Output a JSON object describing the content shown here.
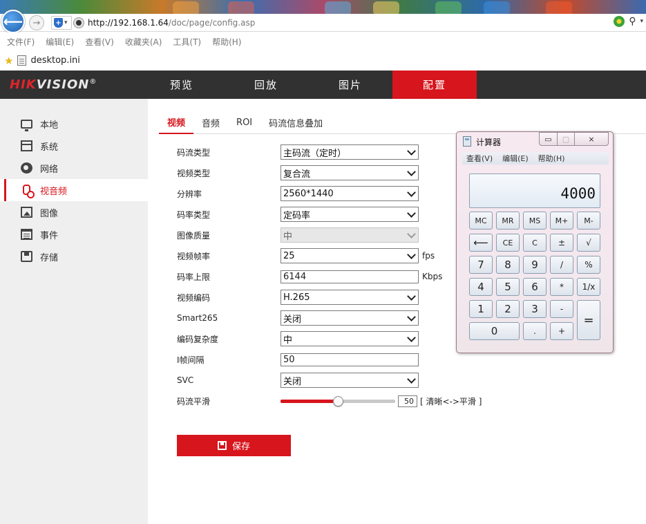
{
  "browser": {
    "url_host": "http://192.168.1.64",
    "url_path": "/doc/page/config.asp",
    "menu": [
      "文件(F)",
      "编辑(E)",
      "查看(V)",
      "收藏夹(A)",
      "工具(T)",
      "帮助(H)"
    ],
    "favorite": "desktop.ini"
  },
  "header": {
    "logo_red": "HIK",
    "logo_white": "VISION",
    "logo_reg": "®",
    "nav": [
      "预览",
      "回放",
      "图片",
      "配置"
    ],
    "active_nav": "配置"
  },
  "sidebar": {
    "items": [
      {
        "label": "本地",
        "icon": "monitor-icon"
      },
      {
        "label": "系统",
        "icon": "system-icon"
      },
      {
        "label": "网络",
        "icon": "globe-icon"
      },
      {
        "label": "视音频",
        "icon": "microphone-icon"
      },
      {
        "label": "图像",
        "icon": "image-icon"
      },
      {
        "label": "事件",
        "icon": "calendar-icon"
      },
      {
        "label": "存储",
        "icon": "storage-icon"
      }
    ],
    "active": "视音频"
  },
  "tabs": [
    "视频",
    "音频",
    "ROI",
    "码流信息叠加"
  ],
  "active_tab": "视频",
  "form": {
    "stream_type": {
      "label": "码流类型",
      "value": "主码流（定时）"
    },
    "video_type": {
      "label": "视频类型",
      "value": "复合流"
    },
    "resolution": {
      "label": "分辨率",
      "value": "2560*1440"
    },
    "bitrate_type": {
      "label": "码率类型",
      "value": "定码率"
    },
    "image_quality": {
      "label": "图像质量",
      "value": "中"
    },
    "frame_rate": {
      "label": "视频帧率",
      "value": "25",
      "unit": "fps"
    },
    "max_bitrate": {
      "label": "码率上限",
      "value": "6144",
      "unit": "Kbps"
    },
    "video_encoding": {
      "label": "视频编码",
      "value": "H.265"
    },
    "smart265": {
      "label": "Smart265",
      "value": "关闭"
    },
    "encoding_complexity": {
      "label": "编码复杂度",
      "value": "中"
    },
    "i_frame_interval": {
      "label": "I帧间隔",
      "value": "50"
    },
    "svc": {
      "label": "SVC",
      "value": "关闭"
    },
    "smoothing": {
      "label": "码流平滑",
      "value": "50",
      "level": 50,
      "hint": "[ 清晰<->平滑 ]"
    }
  },
  "save_label": "保存",
  "calculator": {
    "title": "计算器",
    "menu": [
      "查看(V)",
      "编辑(E)",
      "帮助(H)"
    ],
    "display": "4000",
    "controls": {
      "min": "▭",
      "max": "▢",
      "close": "⨯"
    },
    "keys": {
      "mc": "MC",
      "mr": "MR",
      "ms": "MS",
      "mplus": "M+",
      "mminus": "M-",
      "back": "⟵",
      "ce": "CE",
      "c": "C",
      "pm": "±",
      "sqrt": "√",
      "k7": "7",
      "k8": "8",
      "k9": "9",
      "div": "/",
      "pct": "%",
      "k4": "4",
      "k5": "5",
      "k6": "6",
      "mul": "*",
      "recip": "1/x",
      "k1": "1",
      "k2": "2",
      "k3": "3",
      "sub": "-",
      "eq": "=",
      "k0": "0",
      "dot": ".",
      "add": "+"
    }
  }
}
